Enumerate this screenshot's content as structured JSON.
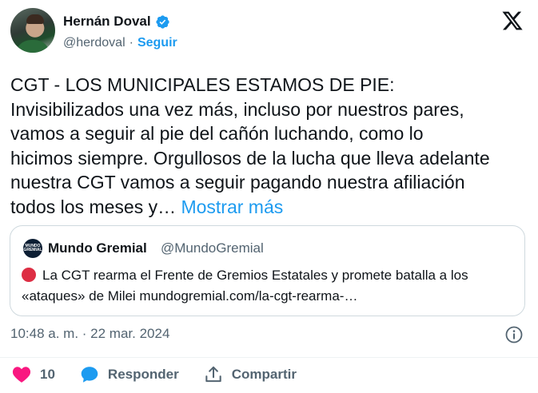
{
  "author": {
    "display_name": "Hernán Doval",
    "handle": "@herdoval",
    "separator": "·",
    "follow_label": "Seguir"
  },
  "tweet": {
    "text": "CGT - LOS MUNICIPALES ESTAMOS DE PIE:\nInvisibilizados una vez más, incluso por nuestros pares,\nvamos a seguir al pie del cañón luchando, como lo\nhicimos siempre. Orgullosos de la lucha que lleva adelante\nnuestra CGT vamos a seguir pagando nuestra afiliación\ntodos los meses y… ",
    "show_more_label": "Mostrar más"
  },
  "quote": {
    "avatar_text": "MUNDO GREMIAL",
    "name": "Mundo Gremial",
    "handle": "@MundoGremial",
    "text": "La CGT rearma el Frente de Gremios Estatales y promete batalla a los «ataques» de Milei mundogremial.com/la-cgt-rearma-…"
  },
  "meta": {
    "timestamp": "10:48 a. m. · 22 mar. 2024"
  },
  "actions": {
    "like_count": "10",
    "reply_label": "Responder",
    "share_label": "Compartir"
  },
  "colors": {
    "accent": "#1d9bf0",
    "like": "#f91880",
    "secondary_text": "#536471",
    "quote_emoji": "#dd2e44"
  },
  "icons": {
    "verified": "verified-badge-icon",
    "brand": "x-logo-icon",
    "info": "info-icon",
    "like": "heart-icon",
    "reply": "speech-bubble-icon",
    "share": "share-upload-icon"
  }
}
